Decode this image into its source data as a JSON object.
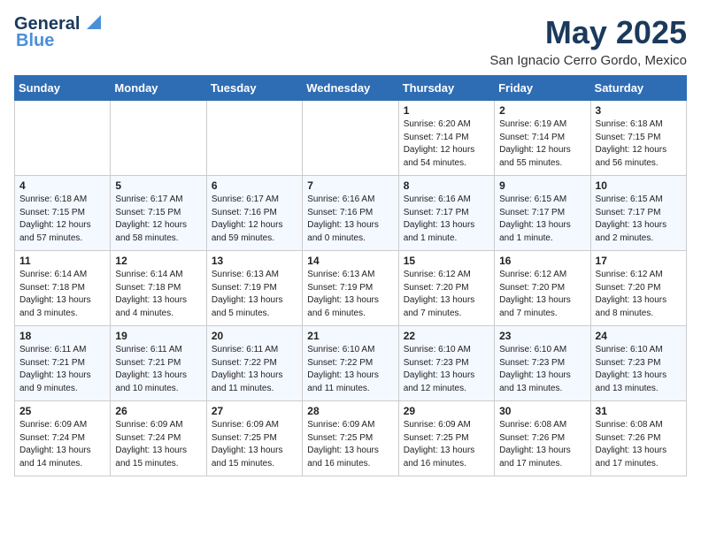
{
  "header": {
    "logo_line1": "General",
    "logo_line2": "Blue",
    "month": "May 2025",
    "location": "San Ignacio Cerro Gordo, Mexico"
  },
  "weekdays": [
    "Sunday",
    "Monday",
    "Tuesday",
    "Wednesday",
    "Thursday",
    "Friday",
    "Saturday"
  ],
  "weeks": [
    [
      {
        "day": "",
        "info": ""
      },
      {
        "day": "",
        "info": ""
      },
      {
        "day": "",
        "info": ""
      },
      {
        "day": "",
        "info": ""
      },
      {
        "day": "1",
        "info": "Sunrise: 6:20 AM\nSunset: 7:14 PM\nDaylight: 12 hours\nand 54 minutes."
      },
      {
        "day": "2",
        "info": "Sunrise: 6:19 AM\nSunset: 7:14 PM\nDaylight: 12 hours\nand 55 minutes."
      },
      {
        "day": "3",
        "info": "Sunrise: 6:18 AM\nSunset: 7:15 PM\nDaylight: 12 hours\nand 56 minutes."
      }
    ],
    [
      {
        "day": "4",
        "info": "Sunrise: 6:18 AM\nSunset: 7:15 PM\nDaylight: 12 hours\nand 57 minutes."
      },
      {
        "day": "5",
        "info": "Sunrise: 6:17 AM\nSunset: 7:15 PM\nDaylight: 12 hours\nand 58 minutes."
      },
      {
        "day": "6",
        "info": "Sunrise: 6:17 AM\nSunset: 7:16 PM\nDaylight: 12 hours\nand 59 minutes."
      },
      {
        "day": "7",
        "info": "Sunrise: 6:16 AM\nSunset: 7:16 PM\nDaylight: 13 hours\nand 0 minutes."
      },
      {
        "day": "8",
        "info": "Sunrise: 6:16 AM\nSunset: 7:17 PM\nDaylight: 13 hours\nand 1 minute."
      },
      {
        "day": "9",
        "info": "Sunrise: 6:15 AM\nSunset: 7:17 PM\nDaylight: 13 hours\nand 1 minute."
      },
      {
        "day": "10",
        "info": "Sunrise: 6:15 AM\nSunset: 7:17 PM\nDaylight: 13 hours\nand 2 minutes."
      }
    ],
    [
      {
        "day": "11",
        "info": "Sunrise: 6:14 AM\nSunset: 7:18 PM\nDaylight: 13 hours\nand 3 minutes."
      },
      {
        "day": "12",
        "info": "Sunrise: 6:14 AM\nSunset: 7:18 PM\nDaylight: 13 hours\nand 4 minutes."
      },
      {
        "day": "13",
        "info": "Sunrise: 6:13 AM\nSunset: 7:19 PM\nDaylight: 13 hours\nand 5 minutes."
      },
      {
        "day": "14",
        "info": "Sunrise: 6:13 AM\nSunset: 7:19 PM\nDaylight: 13 hours\nand 6 minutes."
      },
      {
        "day": "15",
        "info": "Sunrise: 6:12 AM\nSunset: 7:20 PM\nDaylight: 13 hours\nand 7 minutes."
      },
      {
        "day": "16",
        "info": "Sunrise: 6:12 AM\nSunset: 7:20 PM\nDaylight: 13 hours\nand 7 minutes."
      },
      {
        "day": "17",
        "info": "Sunrise: 6:12 AM\nSunset: 7:20 PM\nDaylight: 13 hours\nand 8 minutes."
      }
    ],
    [
      {
        "day": "18",
        "info": "Sunrise: 6:11 AM\nSunset: 7:21 PM\nDaylight: 13 hours\nand 9 minutes."
      },
      {
        "day": "19",
        "info": "Sunrise: 6:11 AM\nSunset: 7:21 PM\nDaylight: 13 hours\nand 10 minutes."
      },
      {
        "day": "20",
        "info": "Sunrise: 6:11 AM\nSunset: 7:22 PM\nDaylight: 13 hours\nand 11 minutes."
      },
      {
        "day": "21",
        "info": "Sunrise: 6:10 AM\nSunset: 7:22 PM\nDaylight: 13 hours\nand 11 minutes."
      },
      {
        "day": "22",
        "info": "Sunrise: 6:10 AM\nSunset: 7:23 PM\nDaylight: 13 hours\nand 12 minutes."
      },
      {
        "day": "23",
        "info": "Sunrise: 6:10 AM\nSunset: 7:23 PM\nDaylight: 13 hours\nand 13 minutes."
      },
      {
        "day": "24",
        "info": "Sunrise: 6:10 AM\nSunset: 7:23 PM\nDaylight: 13 hours\nand 13 minutes."
      }
    ],
    [
      {
        "day": "25",
        "info": "Sunrise: 6:09 AM\nSunset: 7:24 PM\nDaylight: 13 hours\nand 14 minutes."
      },
      {
        "day": "26",
        "info": "Sunrise: 6:09 AM\nSunset: 7:24 PM\nDaylight: 13 hours\nand 15 minutes."
      },
      {
        "day": "27",
        "info": "Sunrise: 6:09 AM\nSunset: 7:25 PM\nDaylight: 13 hours\nand 15 minutes."
      },
      {
        "day": "28",
        "info": "Sunrise: 6:09 AM\nSunset: 7:25 PM\nDaylight: 13 hours\nand 16 minutes."
      },
      {
        "day": "29",
        "info": "Sunrise: 6:09 AM\nSunset: 7:25 PM\nDaylight: 13 hours\nand 16 minutes."
      },
      {
        "day": "30",
        "info": "Sunrise: 6:08 AM\nSunset: 7:26 PM\nDaylight: 13 hours\nand 17 minutes."
      },
      {
        "day": "31",
        "info": "Sunrise: 6:08 AM\nSunset: 7:26 PM\nDaylight: 13 hours\nand 17 minutes."
      }
    ]
  ]
}
